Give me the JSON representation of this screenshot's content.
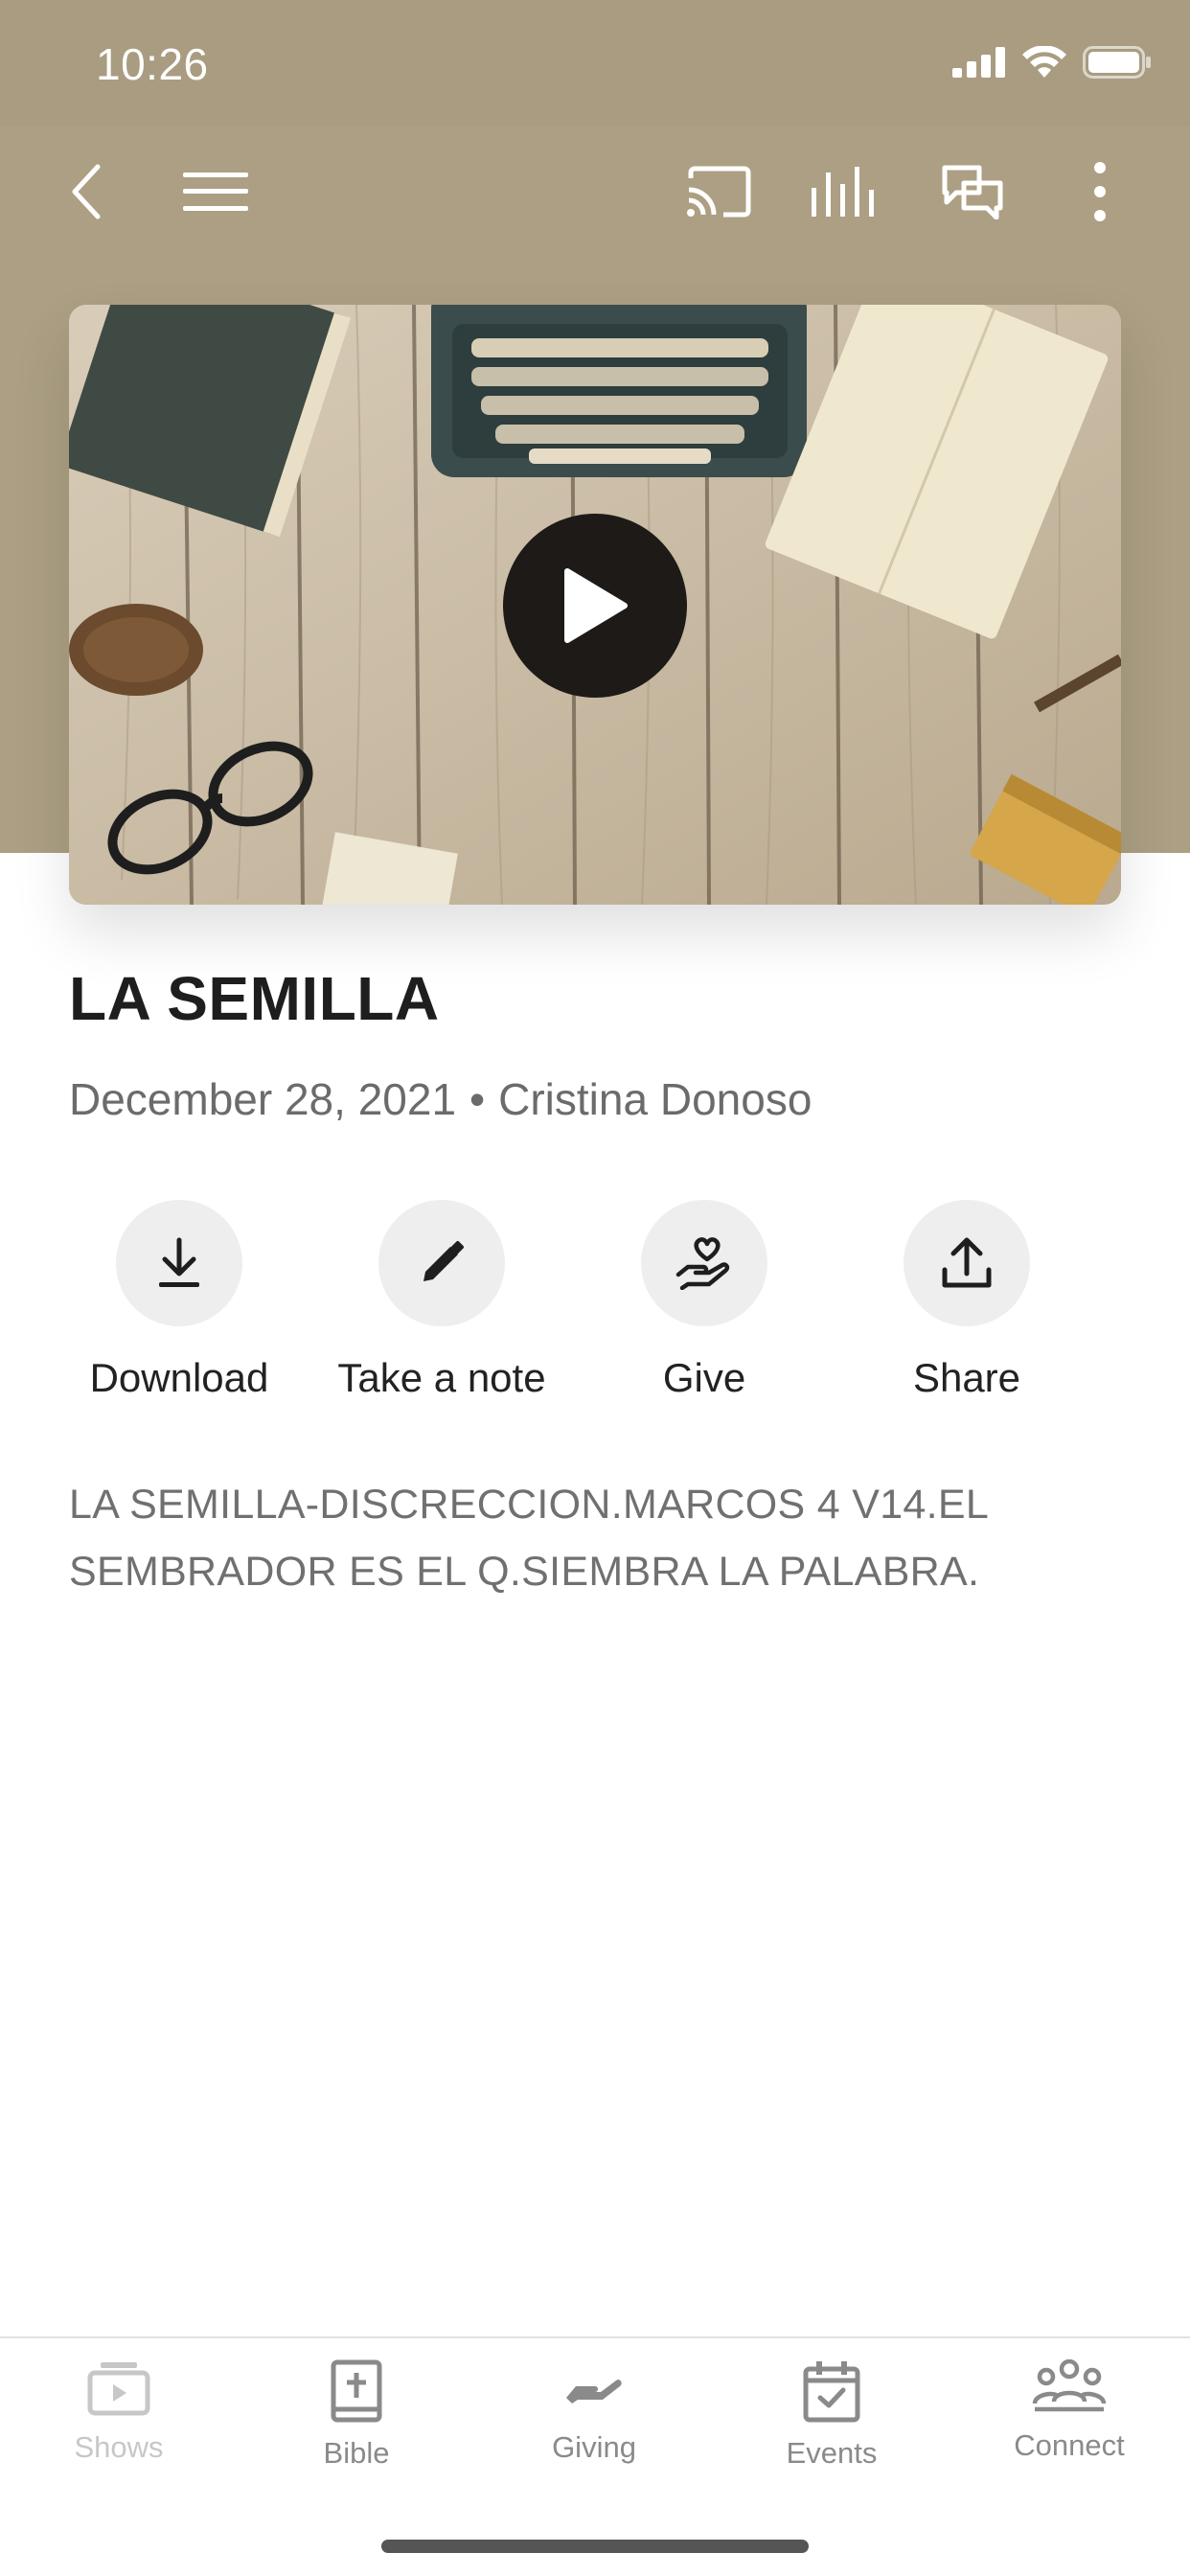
{
  "status_bar": {
    "time": "10:26"
  },
  "toolbar": {
    "back_icon": "chevron-left-icon",
    "menu_icon": "hamburger-menu-icon",
    "cast_icon": "cast-icon",
    "audio_icon": "audio-bars-icon",
    "chat_icon": "chat-bubbles-icon",
    "more_icon": "more-vertical-icon"
  },
  "video": {
    "play_icon": "play-icon"
  },
  "sermon": {
    "title": "LA SEMILLA",
    "date": "December 28, 2021",
    "separator": "•",
    "speaker": "Cristina Donoso",
    "description": "LA SEMILLA-DISCRECCION.MARCOS 4 V14.EL SEMBRADOR ES EL Q.SIEMBRA LA PALABRA."
  },
  "actions": [
    {
      "label": "Download",
      "icon": "download-icon"
    },
    {
      "label": "Take a note",
      "icon": "pencil-icon"
    },
    {
      "label": "Give",
      "icon": "give-heart-hand-icon"
    },
    {
      "label": "Share",
      "icon": "share-icon"
    }
  ],
  "bottom_nav": [
    {
      "label": "Shows",
      "icon": "shows-icon"
    },
    {
      "label": "Bible",
      "icon": "bible-icon"
    },
    {
      "label": "Giving",
      "icon": "giving-hand-icon"
    },
    {
      "label": "Events",
      "icon": "calendar-icon"
    },
    {
      "label": "Connect",
      "icon": "people-icon"
    }
  ],
  "colors": {
    "header": "#ac9f83",
    "text": "#1e1e1e",
    "muted": "#6b6b6b",
    "nav": "#8a8a8a"
  }
}
